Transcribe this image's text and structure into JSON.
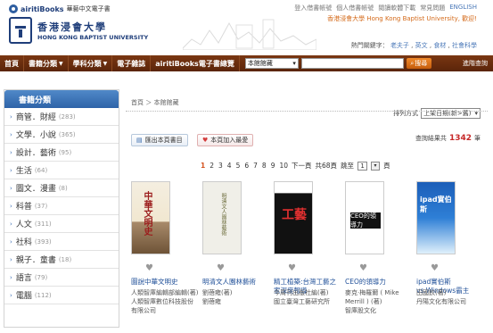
{
  "brand": {
    "name": "airitiBooks",
    "sub": "華藝中文電子書"
  },
  "hkbu": {
    "cn": "香港浸會大學",
    "en": "HONG KONG BAPTIST UNIVERSITY"
  },
  "toplinks": [
    "登入借書帳號",
    "個人借書帳號",
    "閱讀軟體下載",
    "常見問題",
    "ENGLISH"
  ],
  "uni_banner": "香港浸會大學 Hong Kong Baptist University, 歡迎!",
  "hotwords": {
    "label": "熱門關鍵字：",
    "items": [
      "老夫子",
      "英文",
      "食材",
      "社會科學"
    ]
  },
  "nav": {
    "home": "首頁",
    "book_cat": "書籍分類",
    "subject_cat": "學科分類",
    "emag": "電子雜誌",
    "airiti": "airitiBooks電子書總覽",
    "scope": "本館館藏",
    "search_placeholder": "",
    "search_btn": "搜尋",
    "adv": "進階查詢"
  },
  "sidebar": {
    "title": "書籍分類",
    "items": [
      {
        "label": "商管．財經",
        "count": "(283)"
      },
      {
        "label": "文學．小說",
        "count": "(365)"
      },
      {
        "label": "設計．藝術",
        "count": "(95)"
      },
      {
        "label": "生活",
        "count": "(64)"
      },
      {
        "label": "圖文．漫畫",
        "count": "(8)"
      },
      {
        "label": "科普",
        "count": "(37)"
      },
      {
        "label": "人文",
        "count": "(311)"
      },
      {
        "label": "社科",
        "count": "(393)"
      },
      {
        "label": "親子．童書",
        "count": "(18)"
      },
      {
        "label": "語言",
        "count": "(79)"
      },
      {
        "label": "電腦",
        "count": "(112)"
      }
    ]
  },
  "main": {
    "breadcrumb": "首頁 ＞ 本館館藏",
    "sort_label": "排列方式",
    "sort_value": "上架日期(新>舊)",
    "export_label": "匯出本頁書目",
    "fav_label": "本頁加入最愛",
    "result_pre": "查詢結果共",
    "result_num": "1342",
    "result_post": "筆",
    "pages": [
      "1",
      "2",
      "3",
      "4",
      "5",
      "6",
      "7",
      "8",
      "9",
      "10"
    ],
    "next": "下一頁",
    "total_pages": "共68頁",
    "jump_label": "跳至",
    "jump_value": "1",
    "jump_unit": "頁"
  },
  "books": [
    {
      "title": "圖說中華文明史",
      "author": "人類智庫編輯部編輯(著)",
      "publisher": "人類智庫數位科技股份有限公司",
      "cover_text": "中華文明史"
    },
    {
      "title": "明清文人園林藝術",
      "author": "劉蓓雍(著)",
      "publisher": "劉蓓雍",
      "cover_text": "明清文人園林藝術"
    },
    {
      "title": "精工植築:台灣工藝之家深度報導",
      "author": "今周刊出版社編(著)",
      "publisher": "國立臺灣工藝研究所",
      "cover_text": "工藝"
    },
    {
      "title": "CEO的領導力",
      "author": "麥克·梅羅爾 ( Mike Merrill ) (著)",
      "publisher": "智庫股文化",
      "cover_text": "CEO的領導力"
    },
    {
      "title": "ipad實伯斯 vs.Windows霸主",
      "author": "田國欽(著)",
      "publisher": "丹陽文化有限公司",
      "cover_text": "ipad實伯斯"
    }
  ]
}
